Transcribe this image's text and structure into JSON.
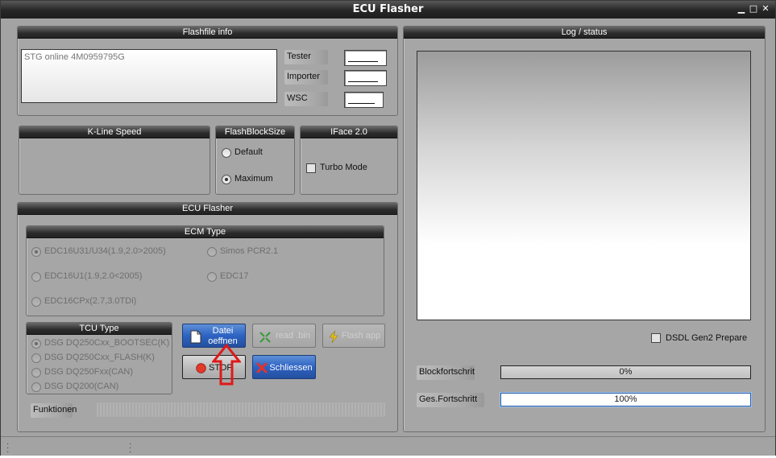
{
  "window": {
    "title": "ECU Flasher",
    "controls": [
      "▁",
      "□",
      "✕"
    ]
  },
  "flashfile": {
    "title": "Flashfile info",
    "info_text": "STG online 4M0959795G",
    "tester_label": "Tester",
    "importer_label": "Importer",
    "wsc_label": "WSC"
  },
  "kline": {
    "title": "K-Line Speed"
  },
  "flashblock": {
    "title": "FlashBlockSize",
    "default_label": "Default",
    "maximum_label": "Maximum",
    "selected": "Maximum"
  },
  "iface": {
    "title": "IFace 2.0",
    "turbo_label": "Turbo Mode"
  },
  "ecu_flasher": {
    "title": "ECU Flasher",
    "ecm_type": {
      "title": "ECM Type",
      "options": [
        "EDC16U31/U34(1.9,2.0>2005)",
        "Simos PCR2.1",
        "EDC16U1(1.9,2.0<2005)",
        "EDC17",
        "EDC16CPx(2.7,3.0TDi)"
      ],
      "selected": "EDC16U31/U34(1.9,2.0>2005)"
    },
    "tcu_type": {
      "title": "TCU Type",
      "options": [
        "DSG DQ250Cxx_BOOTSEC(K)",
        "DSG DQ250Cxx_FLASH(K)",
        "DSG DQ250Fxx(CAN)",
        "DSG DQ200(CAN)"
      ],
      "selected": "DSG DQ250Cxx_BOOTSEC(K)"
    },
    "buttons": {
      "open_line1": "Datei",
      "open_line2": "oeffnen",
      "read_bin": "read .bin",
      "flash_app": "Flash app",
      "stop": "STOP",
      "close": "Schliessen"
    },
    "functions_label": "Funktionen"
  },
  "log": {
    "title": "Log / status",
    "dsdl_label": "DSDL Gen2 Prepare",
    "block_label": "Blockfortschritt",
    "block_value": "0%",
    "block_progress": 0,
    "total_label": "Ges.Fortschritt",
    "total_value": "100%",
    "total_progress": 100
  },
  "colors": {
    "titlebar": "#262626",
    "panel": "#a6a6a6",
    "accent_blue": "#2d63c3",
    "annotation_red": "#e01818"
  }
}
